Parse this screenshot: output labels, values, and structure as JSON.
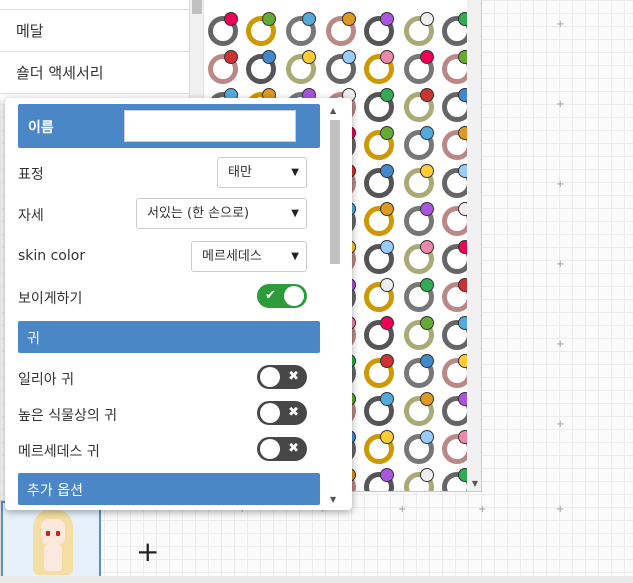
{
  "categories": {
    "items": [
      {
        "label": ""
      },
      {
        "label": "메달"
      },
      {
        "label": "숄더 액세서리"
      }
    ]
  },
  "properties": {
    "name": {
      "label": "이름",
      "value": ""
    },
    "expression": {
      "label": "표정",
      "value": "태만"
    },
    "pose": {
      "label": "자세",
      "value": "서있는 (한 손으로)"
    },
    "skin_color": {
      "label": "skin color",
      "value": "메르세데스"
    },
    "visible": {
      "label": "보이게하기",
      "on": true
    },
    "ears_section": {
      "label": "귀"
    },
    "elf_ear": {
      "label": "일리아 귀",
      "on": false
    },
    "high_flora_ear": {
      "label": "높은 식물상의 귀",
      "on": false
    },
    "mercedes_ear": {
      "label": "메르세데스 귀",
      "on": false
    },
    "extra_section": {
      "label": "추가 옵션"
    }
  },
  "toolbar": {
    "add_character": "+"
  },
  "colors": {
    "accent": "#4b87c7",
    "toggle_on": "#2d9b3a",
    "toggle_off": "#474747"
  }
}
